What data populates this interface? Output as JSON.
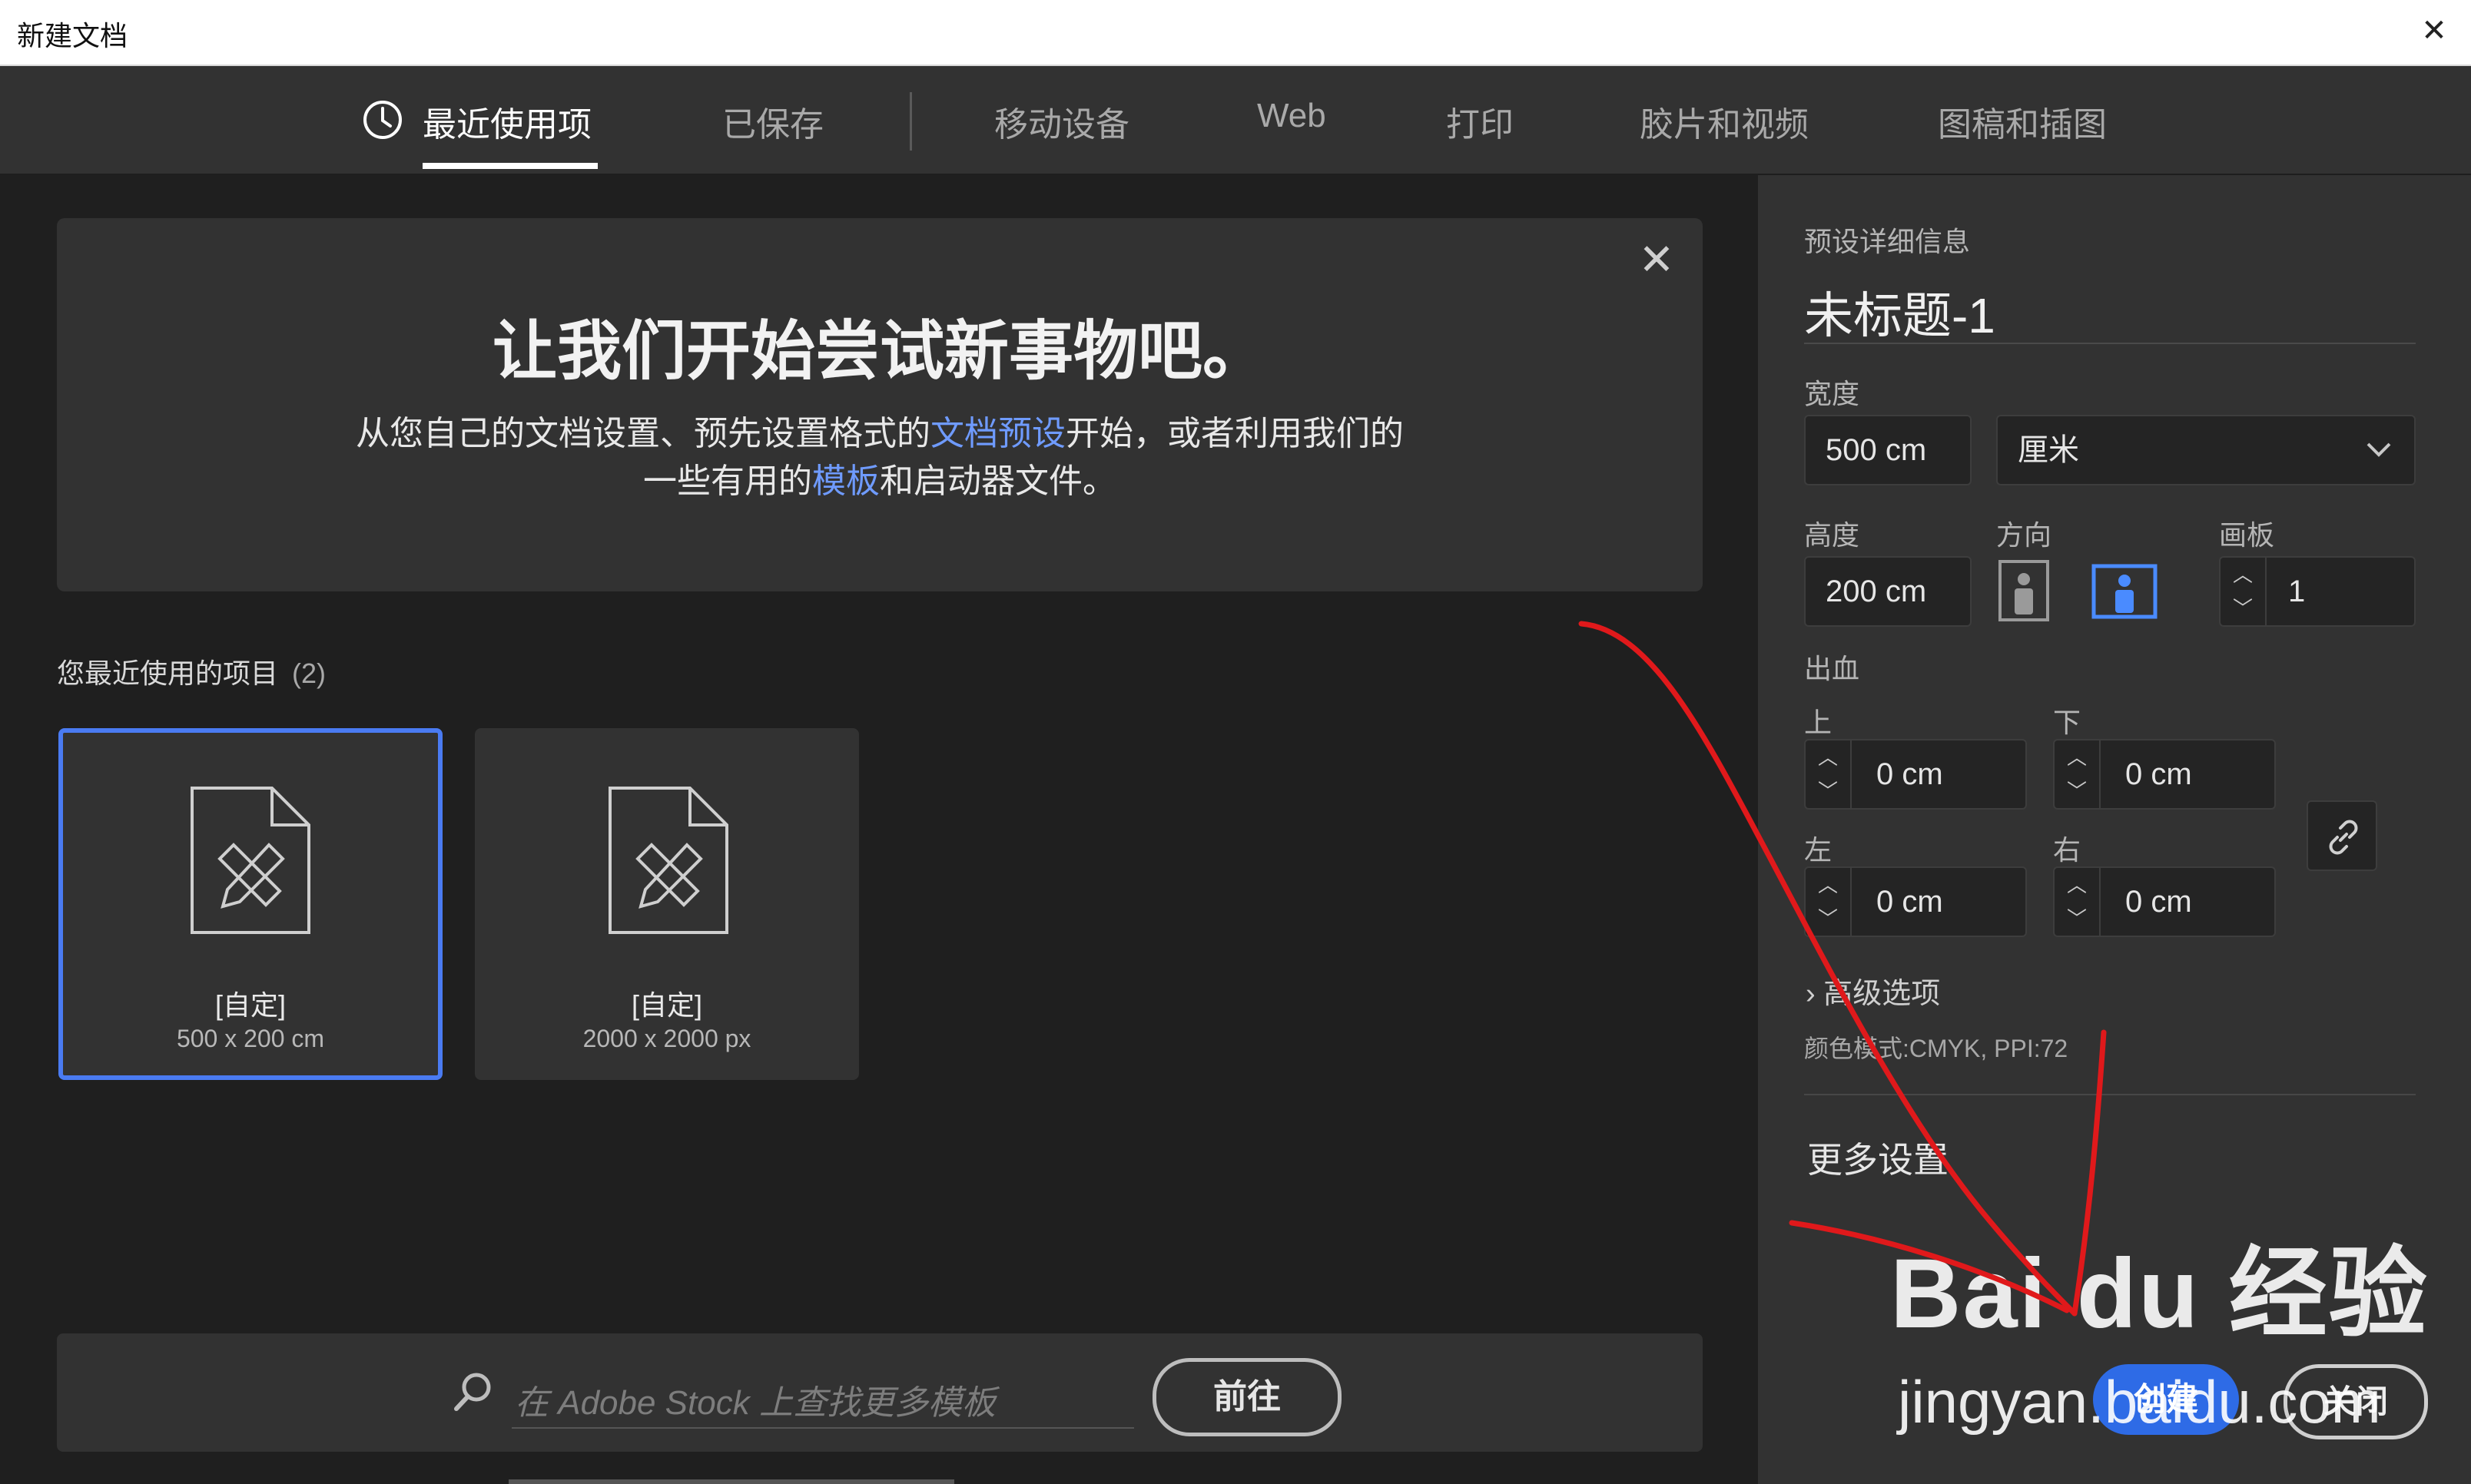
{
  "window": {
    "title": "新建文档",
    "close_glyph": "✕"
  },
  "tabs": [
    {
      "label": "最近使用项",
      "active": true,
      "icon": "clock-icon"
    },
    {
      "label": "已保存"
    },
    {
      "label": "移动设备"
    },
    {
      "label": "Web"
    },
    {
      "label": "打印"
    },
    {
      "label": "胶片和视频"
    },
    {
      "label": "图稿和插图"
    }
  ],
  "banner": {
    "title": "让我们开始尝试新事物吧。",
    "line1_a": "从您自己的文档设置、预先设置格式的",
    "line1_link": "文档预设",
    "line1_b": "开始，或者利用我们的",
    "line2_a": "一些有用的",
    "line2_link": "模板",
    "line2_b": "和启动器文件。",
    "close_glyph": "✕"
  },
  "recent": {
    "label": "您最近使用的项目",
    "count": "(2)",
    "items": [
      {
        "name": "[自定]",
        "size": "500 x 200 cm",
        "selected": true
      },
      {
        "name": "[自定]",
        "size": "2000 x 2000 px"
      }
    ]
  },
  "stock": {
    "placeholder": "在 Adobe Stock 上查找更多模板",
    "go_label": "前往"
  },
  "preset": {
    "header": "预设详细信息",
    "doc_name": "未标题-1",
    "width_label": "宽度",
    "width_value": "500 cm",
    "unit_value": "厘米",
    "height_label": "高度",
    "height_value": "200 cm",
    "orientation_label": "方向",
    "orientation_selected": "landscape",
    "artboards_label": "画板",
    "artboards_value": "1",
    "bleed_label": "出血",
    "bleed_top_label": "上",
    "bleed_top_value": "0 cm",
    "bleed_bottom_label": "下",
    "bleed_bottom_value": "0 cm",
    "bleed_left_label": "左",
    "bleed_left_value": "0 cm",
    "bleed_right_label": "右",
    "bleed_right_value": "0 cm",
    "advanced_label": "高级选项",
    "color_mode_text": "颜色模式:CMYK, PPI:72",
    "more_settings": "更多设置",
    "create_label": "创建",
    "close_label": "关闭"
  },
  "watermark": {
    "brand": "Bai du 经验",
    "url": "jingyan.baidu.com"
  },
  "colors": {
    "accent": "#2e6be6",
    "link": "#6f9bff",
    "selection_border": "#4a7bf2",
    "annotation": "#e0191b"
  }
}
